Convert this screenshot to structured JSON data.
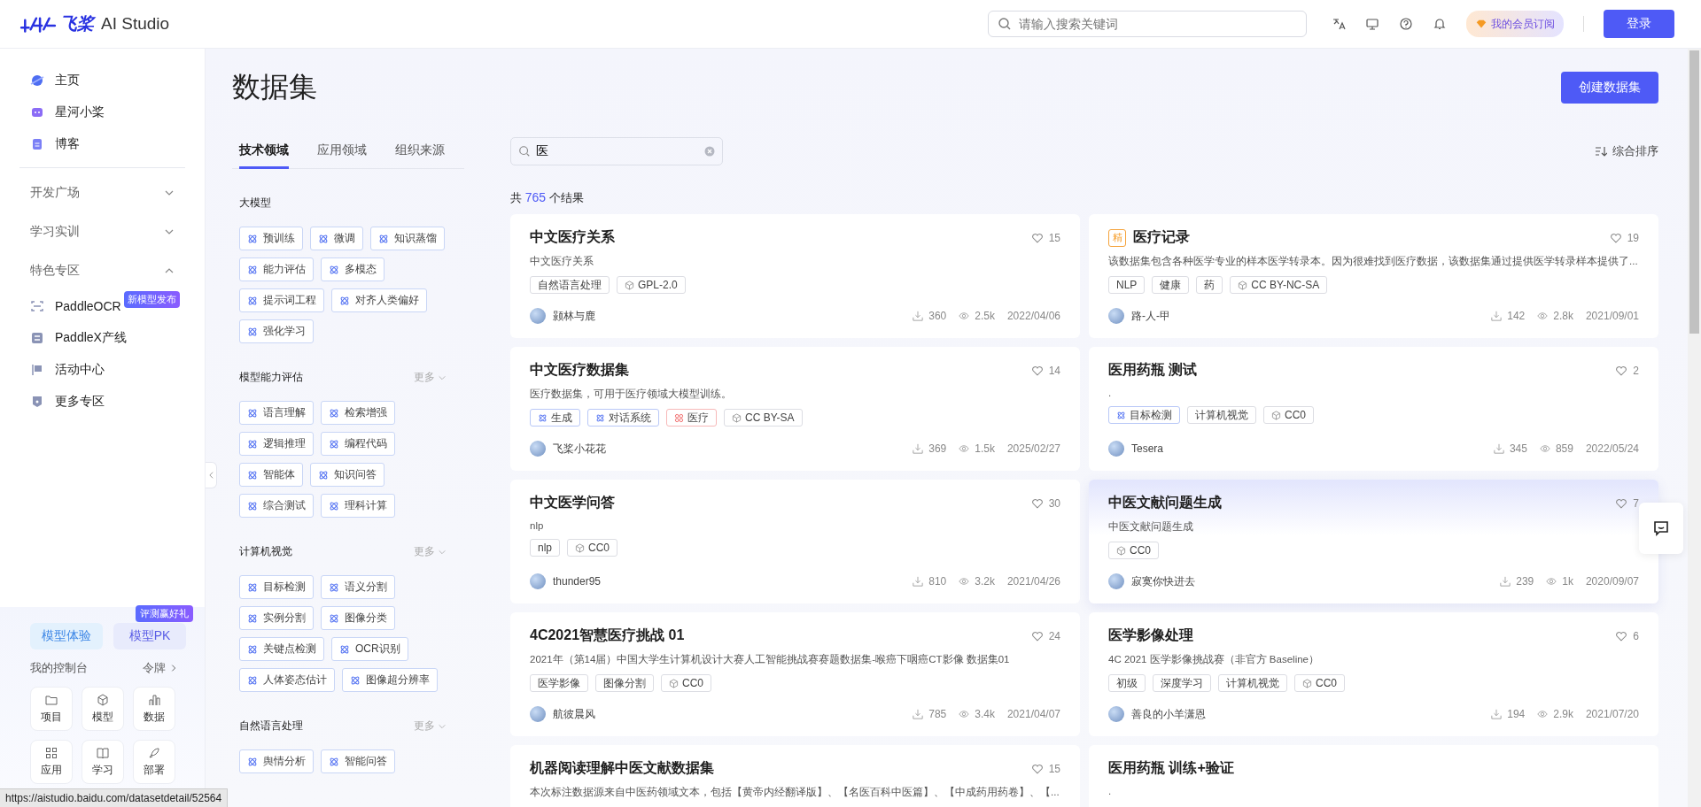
{
  "header": {
    "logo_text": "飞桨",
    "product": "AI Studio",
    "search": {
      "placeholder": "请输入搜索关键词"
    },
    "membership": "我的会员订阅",
    "login": "登录"
  },
  "sidebar": {
    "items": [
      {
        "label": "主页"
      },
      {
        "label": "星河小桨"
      },
      {
        "label": "博客"
      }
    ],
    "sections": [
      {
        "label": "开发广场",
        "expanded": false
      },
      {
        "label": "学习实训",
        "expanded": false
      },
      {
        "label": "特色专区",
        "expanded": true,
        "children": [
          {
            "label": "PaddleOCR",
            "badge": "新模型发布"
          },
          {
            "label": "PaddleX产线"
          },
          {
            "label": "活动中心"
          },
          {
            "label": "更多专区"
          }
        ]
      }
    ],
    "quick_buttons": [
      {
        "label": "模型体验"
      },
      {
        "label": "模型PK",
        "badge": "评测赢好礼"
      }
    ],
    "console": {
      "title": "我的控制台",
      "link": "令牌"
    },
    "tiles": [
      {
        "label": "项目"
      },
      {
        "label": "模型"
      },
      {
        "label": "数据"
      },
      {
        "label": "应用"
      },
      {
        "label": "学习"
      },
      {
        "label": "部署"
      }
    ]
  },
  "page": {
    "title": "数据集",
    "create_button": "创建数据集"
  },
  "filters": {
    "tabs": [
      {
        "label": "技术领域",
        "selected": true
      },
      {
        "label": "应用领域",
        "selected": false
      },
      {
        "label": "组织来源",
        "selected": false
      }
    ],
    "groups": [
      {
        "title": "大模型",
        "tags": [
          "预训练",
          "微调",
          "知识蒸馏",
          "能力评估",
          "多模态",
          "提示词工程",
          "对齐人类偏好",
          "强化学习"
        ]
      },
      {
        "title": "模型能力评估",
        "more": "更多",
        "tags": [
          "语言理解",
          "检索增强",
          "逻辑推理",
          "编程代码",
          "智能体",
          "知识问答",
          "综合测试",
          "理科计算"
        ]
      },
      {
        "title": "计算机视觉",
        "more": "更多",
        "tags": [
          "目标检测",
          "语义分割",
          "实例分割",
          "图像分类",
          "关键点检测",
          "OCR识别",
          "人体姿态估计",
          "图像超分辨率"
        ]
      },
      {
        "title": "自然语言处理",
        "more": "更多",
        "tags": [
          "舆情分析",
          "智能问答"
        ]
      }
    ]
  },
  "results": {
    "search_value": "医",
    "count_prefix": "共",
    "count": "765",
    "count_suffix": "个结果",
    "sort": "综合排序"
  },
  "cards": [
    {
      "title": "中文医疗关系",
      "likes": "15",
      "description": "中文医疗关系",
      "tags": [
        {
          "label": "自然语言处理",
          "kind": "plain"
        },
        {
          "label": "GPL-2.0",
          "kind": "license"
        }
      ],
      "author": "颢林与鹿",
      "downloads": "360",
      "views": "2.5k",
      "date": "2022/04/06",
      "highlighted": false
    },
    {
      "title": "医疗记录",
      "badge": "精",
      "likes": "19",
      "description": "该数据集包含各种医学专业的样本医学转录本。因为很难找到医疗数据，该数据集通过提供医学转录样本提供了...",
      "tags": [
        {
          "label": "NLP",
          "kind": "plain"
        },
        {
          "label": "健康",
          "kind": "plain"
        },
        {
          "label": "药",
          "kind": "plain"
        },
        {
          "label": "CC BY-NC-SA",
          "kind": "license"
        }
      ],
      "author": "路-人-甲",
      "downloads": "142",
      "views": "2.8k",
      "date": "2021/09/01",
      "highlighted": false
    },
    {
      "title": "中文医疗数据集",
      "likes": "14",
      "description": "医疗数据集，可用于医疗领域大模型训练。",
      "tags": [
        {
          "label": "生成",
          "kind": "tech"
        },
        {
          "label": "对话系统",
          "kind": "tech"
        },
        {
          "label": "医疗",
          "kind": "domain"
        },
        {
          "label": "CC BY-SA",
          "kind": "license"
        }
      ],
      "author": "飞桨小花花",
      "downloads": "369",
      "views": "1.5k",
      "date": "2025/02/27",
      "highlighted": false
    },
    {
      "title": "医用药瓶 测试",
      "likes": "2",
      "description": ".",
      "tags": [
        {
          "label": "目标检测",
          "kind": "tech"
        },
        {
          "label": "计算机视觉",
          "kind": "plain"
        },
        {
          "label": "CC0",
          "kind": "license"
        }
      ],
      "author": "Tesera",
      "downloads": "345",
      "views": "859",
      "date": "2022/05/24",
      "highlighted": false
    },
    {
      "title": "中文医学问答",
      "likes": "30",
      "description": "nlp",
      "tags": [
        {
          "label": "nlp",
          "kind": "plain"
        },
        {
          "label": "CC0",
          "kind": "license"
        }
      ],
      "author": "thunder95",
      "downloads": "810",
      "views": "3.2k",
      "date": "2021/04/26",
      "highlighted": false
    },
    {
      "title": "中医文献问题生成",
      "likes": "7",
      "description": "中医文献问题生成",
      "tags": [
        {
          "label": "CC0",
          "kind": "license"
        }
      ],
      "author": "寂寞你快进去",
      "downloads": "239",
      "views": "1k",
      "date": "2020/09/07",
      "highlighted": true
    },
    {
      "title": "4C2021智慧医疗挑战 01",
      "likes": "24",
      "description": "2021年（第14届）中国大学生计算机设计大赛人工智能挑战赛赛题数据集-喉癌下咽癌CT影像 数据集01",
      "tags": [
        {
          "label": "医学影像",
          "kind": "plain"
        },
        {
          "label": "图像分割",
          "kind": "plain"
        },
        {
          "label": "CC0",
          "kind": "license"
        }
      ],
      "author": "航彼晨风",
      "downloads": "785",
      "views": "3.4k",
      "date": "2021/04/07",
      "highlighted": false
    },
    {
      "title": "医学影像处理",
      "likes": "6",
      "description": "4C 2021 医学影像挑战赛（非官方 Baseline）",
      "tags": [
        {
          "label": "初级",
          "kind": "plain"
        },
        {
          "label": "深度学习",
          "kind": "plain"
        },
        {
          "label": "计算机视觉",
          "kind": "plain"
        },
        {
          "label": "CC0",
          "kind": "license"
        }
      ],
      "author": "善良的小羊潇恩",
      "downloads": "194",
      "views": "2.9k",
      "date": "2021/07/20",
      "highlighted": false
    },
    {
      "title": "机器阅读理解中医文献数据集",
      "likes": "15",
      "description": "本次标注数据源来自中医药领域文本，包括【黄帝内经翻译版】、【名医百科中医篇】、【中成药用药卷】、【...",
      "highlighted": false
    },
    {
      "title": "医用药瓶 训练+验证",
      "description": ".",
      "highlighted": false
    }
  ],
  "status_url": "https://aistudio.baidu.com/datasetdetail/52564"
}
